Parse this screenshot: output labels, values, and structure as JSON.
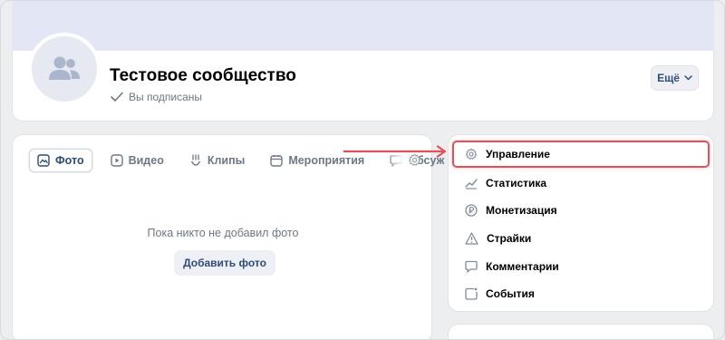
{
  "header": {
    "title": "Тестовое сообщество",
    "subscribed_label": "Вы подписаны",
    "more_button": "Ещё"
  },
  "photos": {
    "tabs": [
      {
        "label": "Фото",
        "icon": "image-icon",
        "active": true
      },
      {
        "label": "Видео",
        "icon": "video-icon",
        "active": false
      },
      {
        "label": "Клипы",
        "icon": "clips-icon",
        "active": false
      },
      {
        "label": "Мероприятия",
        "icon": "calendar-icon",
        "active": false
      },
      {
        "label": "Обсуж",
        "icon": "discussion-icon",
        "active": false
      }
    ],
    "empty_text": "Пока никто не добавил фото",
    "add_button": "Добавить фото"
  },
  "admin_menu": {
    "items": [
      {
        "label": "Управление",
        "icon": "gear-icon",
        "highlighted": true
      },
      {
        "label": "Статистика",
        "icon": "chart-icon"
      },
      {
        "label": "Монетизация",
        "icon": "ruble-icon"
      },
      {
        "label": "Страйки",
        "icon": "warning-icon"
      },
      {
        "label": "Комментарии",
        "icon": "comment-icon"
      },
      {
        "label": "События",
        "icon": "events-icon"
      }
    ]
  },
  "colors": {
    "accent": "#2d4c78",
    "muted": "#6d7885",
    "highlight": "#e0525a"
  }
}
